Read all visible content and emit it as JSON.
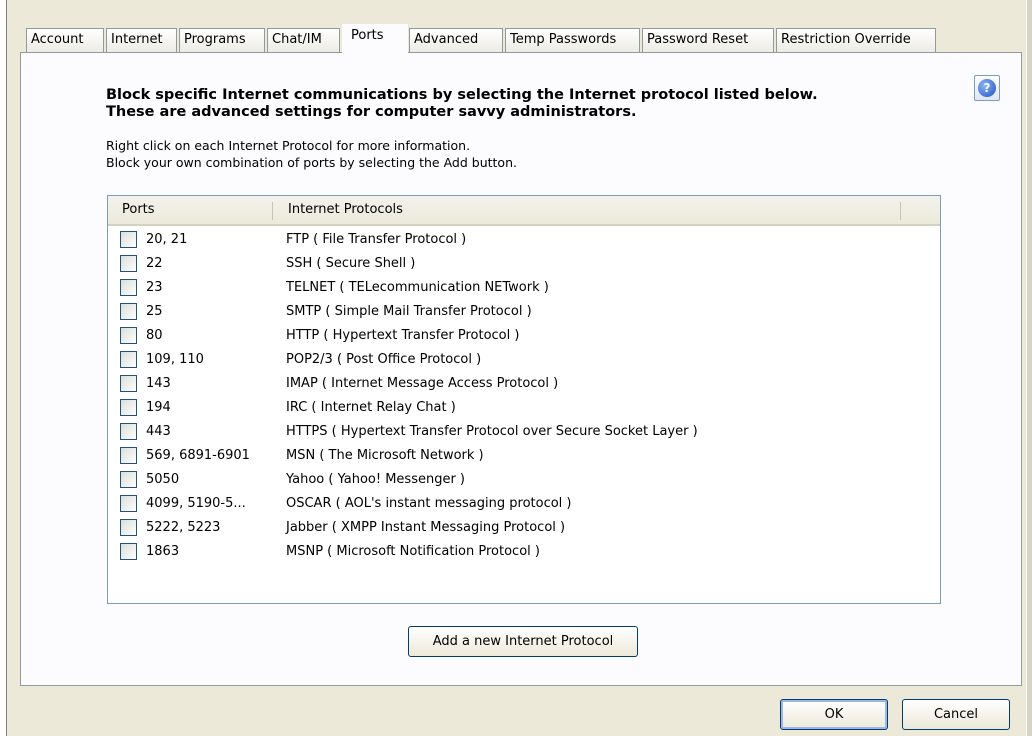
{
  "tabs": [
    {
      "label": "Account",
      "active": false
    },
    {
      "label": "Internet",
      "active": false
    },
    {
      "label": "Programs",
      "active": false
    },
    {
      "label": "Chat/IM",
      "active": false
    },
    {
      "label": "Ports",
      "active": true
    },
    {
      "label": "Advanced",
      "active": false
    },
    {
      "label": "Temp Passwords",
      "active": false
    },
    {
      "label": "Password Reset",
      "active": false
    },
    {
      "label": "Restriction Override",
      "active": false
    }
  ],
  "help_icon": {
    "glyph": "?",
    "name": "help-icon"
  },
  "heading": {
    "line1": "Block specific Internet communications by selecting the Internet protocol listed below.",
    "line2": "These are advanced settings for computer savvy administrators."
  },
  "intro": {
    "line1": "Right click on each Internet Protocol for more information.",
    "line2": "Block your own combination of ports by selecting the Add button."
  },
  "grid": {
    "columns": {
      "ports": "Ports",
      "protocols": "Internet Protocols"
    },
    "rows": [
      {
        "ports": "20, 21",
        "protocol": "FTP ( File Transfer Protocol )",
        "checked": false
      },
      {
        "ports": "22",
        "protocol": "SSH ( Secure Shell )",
        "checked": false
      },
      {
        "ports": "23",
        "protocol": "TELNET ( TELecommunication NETwork )",
        "checked": false
      },
      {
        "ports": "25",
        "protocol": "SMTP ( Simple Mail Transfer Protocol )",
        "checked": false
      },
      {
        "ports": "80",
        "protocol": "HTTP ( Hypertext Transfer Protocol )",
        "checked": false
      },
      {
        "ports": "109, 110",
        "protocol": "POP2/3 ( Post Office Protocol )",
        "checked": false
      },
      {
        "ports": "143",
        "protocol": "IMAP ( Internet Message Access Protocol )",
        "checked": false
      },
      {
        "ports": "194",
        "protocol": "IRC ( Internet Relay Chat )",
        "checked": false
      },
      {
        "ports": "443",
        "protocol": "HTTPS ( Hypertext Transfer Protocol over Secure Socket Layer )",
        "checked": false
      },
      {
        "ports": "569, 6891-6901",
        "protocol": "MSN ( The Microsoft Network )",
        "checked": false
      },
      {
        "ports": "5050",
        "protocol": "Yahoo ( Yahoo! Messenger )",
        "checked": false
      },
      {
        "ports": "4099, 5190-5...",
        "protocol": "OSCAR ( AOL's instant messaging protocol )",
        "checked": false
      },
      {
        "ports": "5222, 5223",
        "protocol": "Jabber ( XMPP Instant Messaging Protocol )",
        "checked": false
      },
      {
        "ports": "1863",
        "protocol": "MSNP ( Microsoft Notification Protocol )",
        "checked": false
      }
    ]
  },
  "buttons": {
    "add": "Add a new Internet Protocol",
    "ok": "OK",
    "cancel": "Cancel"
  },
  "colors": {
    "dialog_bg": "#ece9d8",
    "panel_bg": "#fcfcfe",
    "border_blue": "#7f9db9",
    "checkbox_border": "#1c5180"
  }
}
